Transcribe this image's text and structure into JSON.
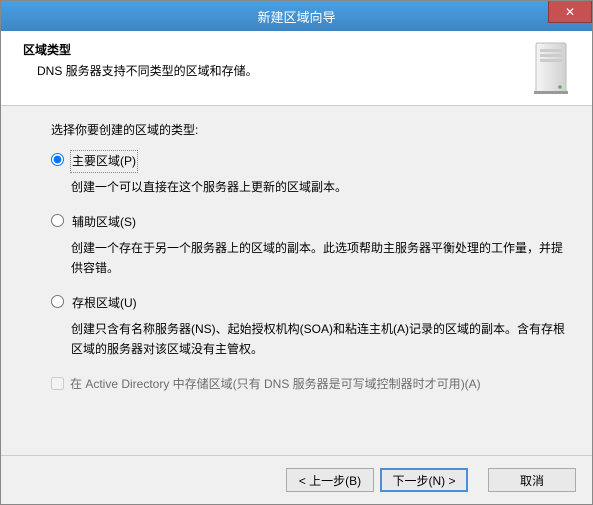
{
  "title": "新建区域向导",
  "header": {
    "title": "区域类型",
    "desc": "DNS 服务器支持不同类型的区域和存储。"
  },
  "body": {
    "prompt": "选择你要创建的区域的类型:",
    "options": {
      "primary": {
        "label": "主要区域(P)",
        "desc": "创建一个可以直接在这个服务器上更新的区域副本。"
      },
      "secondary": {
        "label": "辅助区域(S)",
        "desc": "创建一个存在于另一个服务器上的区域的副本。此选项帮助主服务器平衡处理的工作量，并提供容错。"
      },
      "stub": {
        "label": "存根区域(U)",
        "desc": "创建只含有名称服务器(NS)、起始授权机构(SOA)和粘连主机(A)记录的区域的副本。含有存根区域的服务器对该区域没有主管权。"
      }
    },
    "ad_checkbox": "在 Active Directory 中存储区域(只有 DNS 服务器是可写域控制器时才可用)(A)"
  },
  "footer": {
    "back": "< 上一步(B)",
    "next": "下一步(N) >",
    "cancel": "取消"
  }
}
